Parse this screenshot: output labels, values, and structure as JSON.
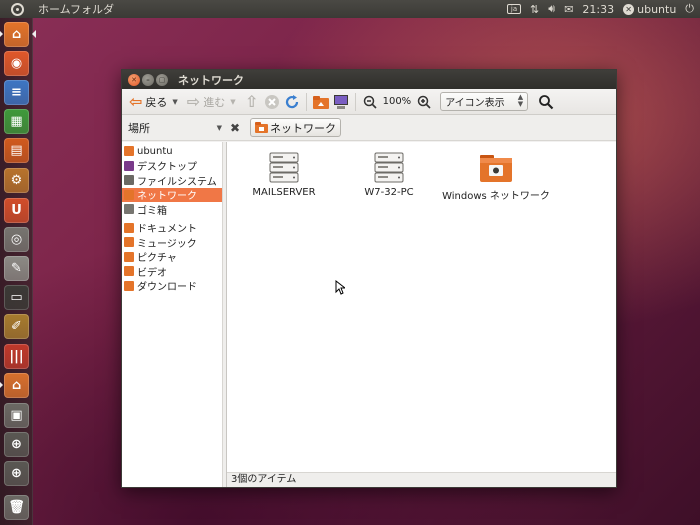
{
  "top_panel": {
    "title": "ホームフォルダ",
    "clock": "21:33",
    "user": "ubuntu",
    "keyboard_label": "⌨"
  },
  "launcher": {
    "items": [
      {
        "name": "home-folder",
        "color": "#e4742a"
      },
      {
        "name": "firefox",
        "color": "#e0582a"
      },
      {
        "name": "libreoffice-writer",
        "color": "#3d76c4"
      },
      {
        "name": "libreoffice-calc",
        "color": "#3f9a3b"
      },
      {
        "name": "libreoffice-impress",
        "color": "#d15a1d"
      },
      {
        "name": "ubuntu-software-center",
        "color": "#b8732c"
      },
      {
        "name": "ubuntu-one",
        "color": "#d24d2a"
      },
      {
        "name": "cheese-camera",
        "color": "#777570"
      },
      {
        "name": "text-editor",
        "color": "#8c8a85"
      },
      {
        "name": "terminal",
        "color": "#3b3a36"
      },
      {
        "name": "color-tools",
        "color": "#a77b2e"
      },
      {
        "name": "color-pencils",
        "color": "#c0392b"
      },
      {
        "name": "workspace-files",
        "color": "#d8702d"
      },
      {
        "name": "workspace-switcher",
        "color": "#6b6964"
      },
      {
        "name": "search-a",
        "color": "#5a5853"
      },
      {
        "name": "search-b",
        "color": "#5a5853"
      },
      {
        "name": "trash",
        "color": "#6b6964"
      }
    ]
  },
  "window": {
    "title": "ネットワーク",
    "toolbar": {
      "back_label": "戻る",
      "forward_label": "進む",
      "zoom_level": "100%",
      "view_mode": "アイコン表示"
    },
    "sidebar_selector": "場所",
    "breadcrumb": "ネットワーク",
    "sidebar": {
      "places": [
        "ubuntu",
        "デスクトップ",
        "ファイルシステム",
        "ネットワーク",
        "ゴミ箱"
      ],
      "bookmarks": [
        "ドキュメント",
        "ミュージック",
        "ピクチャ",
        "ビデオ",
        "ダウンロード"
      ],
      "selected": "ネットワーク"
    },
    "items": [
      {
        "label": "MAILSERVER",
        "icon": "server-icon"
      },
      {
        "label": "W7-32-PC",
        "icon": "server-icon"
      },
      {
        "label": "Windows ネットワーク",
        "icon": "network-folder-icon"
      }
    ],
    "status": "3個のアイテム"
  },
  "colors": {
    "accent": "#f07746",
    "panel": "#3c3b37"
  }
}
